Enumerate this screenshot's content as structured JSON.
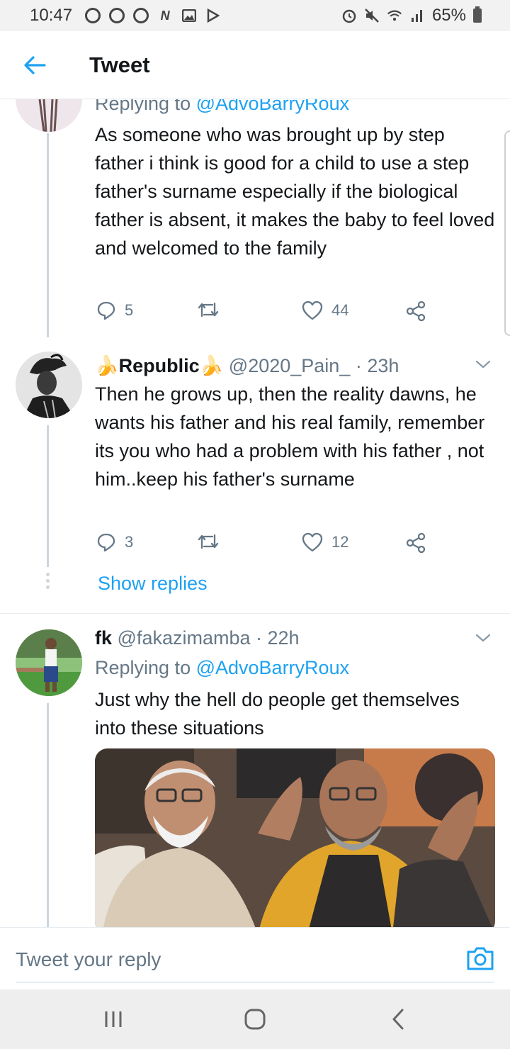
{
  "status_bar": {
    "time": "10:47",
    "battery_text": "65%",
    "left_icons": [
      "notification-icon",
      "notification-icon",
      "notification-icon",
      "nfc-icon",
      "gallery-icon",
      "play-icon"
    ],
    "right_icons": [
      "alarm-icon",
      "mute-icon",
      "wifi-icon",
      "signal-icon",
      "battery-icon"
    ]
  },
  "header": {
    "title": "Tweet",
    "accent": "#1da1f2"
  },
  "tweets": [
    {
      "replying_prefix": "Replying to ",
      "replying_handle": "@AdvoBarryRoux",
      "text": "As someone who was brought up by step father i think is good for a child to use a step father's surname  especially if the biological father is absent, it makes the baby to feel loved and welcomed to the family",
      "replies": "5",
      "retweets": "",
      "likes": "44"
    },
    {
      "emoji_left": "🍌",
      "name": "Republic",
      "emoji_right": "🍌",
      "handle": "@2020_Pain_",
      "time": "· 23h",
      "text": "Then he grows up, then the reality dawns, he wants his father and his real family, remember its you who had a problem with his father , not him..keep his father's surname",
      "replies": "3",
      "retweets": "",
      "likes": "12",
      "show_replies": "Show replies"
    },
    {
      "name": "fk",
      "handle": "@fakazimamba",
      "time": "· 22h",
      "replying_prefix": "Replying to ",
      "replying_handle": "@AdvoBarryRoux",
      "text": "Just why the hell do people get themselves into these situations"
    }
  ],
  "reply_bar": {
    "placeholder": "Tweet your reply"
  },
  "nav": [
    "recents-icon",
    "home-icon",
    "back-icon"
  ]
}
